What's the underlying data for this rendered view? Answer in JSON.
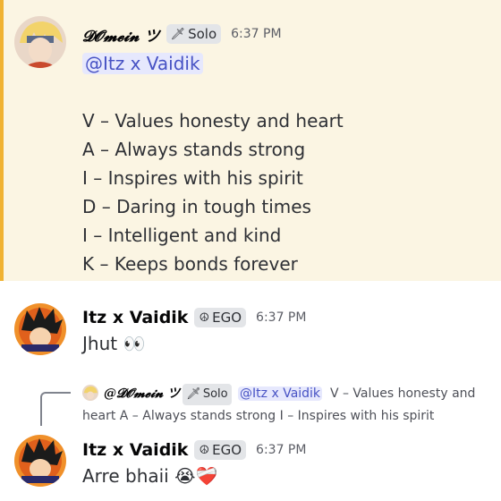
{
  "messages": [
    {
      "username": "𝓓𝓞𝓶𝓮𝓲𝓷 ツ",
      "tag": {
        "icon": "🗡",
        "label": "Solo"
      },
      "time": "6:37 PM",
      "mention": "@Itz x Vaidik",
      "lines": [
        "V – Values honesty and heart",
        "A – Always stands strong",
        "I – Inspires with his spirit",
        "D – Daring in tough times",
        "I – Intelligent and kind",
        "K – Keeps bonds forever"
      ]
    },
    {
      "username": "Itz x Vaidik",
      "tag": {
        "icon": "☮",
        "label": "EGO"
      },
      "time": "6:37 PM",
      "text": "Jhut 👀"
    },
    {
      "reply": {
        "username": "@𝓓𝓞𝓶𝓮𝓲𝓷 ツ",
        "tag": {
          "icon": "🗡",
          "label": "Solo"
        },
        "mention": "@Itz x Vaidik",
        "text": "V – Values honesty and heart A – Always stands strong I – Inspires with his spirit"
      },
      "username": "Itz x Vaidik",
      "tag": {
        "icon": "☮",
        "label": "EGO"
      },
      "time": "6:37 PM",
      "text": "Arre bhaii 😭❤️‍🩹"
    }
  ]
}
